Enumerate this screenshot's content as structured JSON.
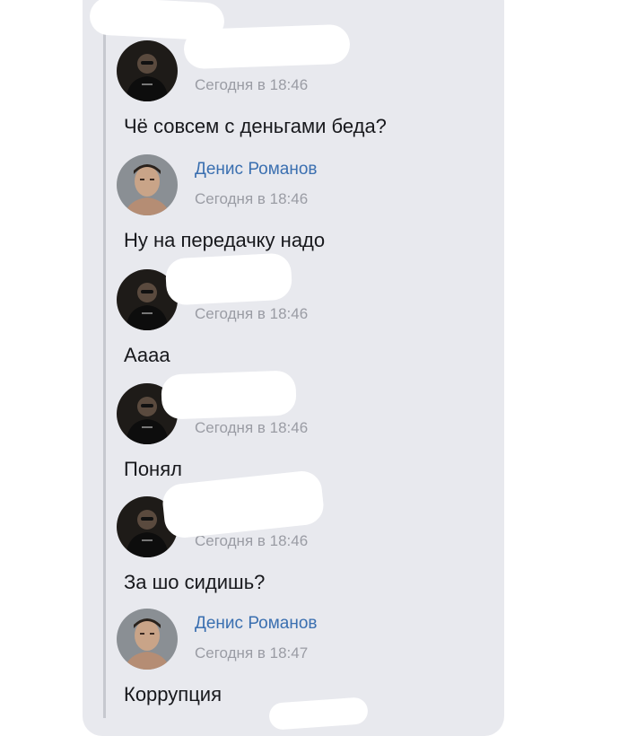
{
  "messages": [
    {
      "author": "",
      "time": "Сегодня в 18:46",
      "text": "Чё совсем с деньгами беда?",
      "avatar": "dark-figure-avatar"
    },
    {
      "author": "Денис Романов",
      "time": "Сегодня в 18:46",
      "text": "Ну на передачку надо",
      "avatar": "man-portrait-avatar"
    },
    {
      "author": "",
      "time": "Сегодня в 18:46",
      "text": "Аааа",
      "avatar": "dark-figure-avatar"
    },
    {
      "author": "",
      "time": "Сегодня в 18:46",
      "text": "Понял",
      "avatar": "dark-figure-avatar"
    },
    {
      "author": "",
      "time": "Сегодня в 18:46",
      "text": "За шо сидишь?",
      "avatar": "dark-figure-avatar"
    },
    {
      "author": "Денис Романов",
      "time": "Сегодня в 18:47",
      "text": "Коррупция",
      "avatar": "man-portrait-avatar"
    }
  ],
  "colors": {
    "background": "#e8e9ee",
    "author": "#3a6fb0",
    "time": "#9a9ca4",
    "text": "#17181c",
    "thread_line": "#c6c8cf"
  }
}
